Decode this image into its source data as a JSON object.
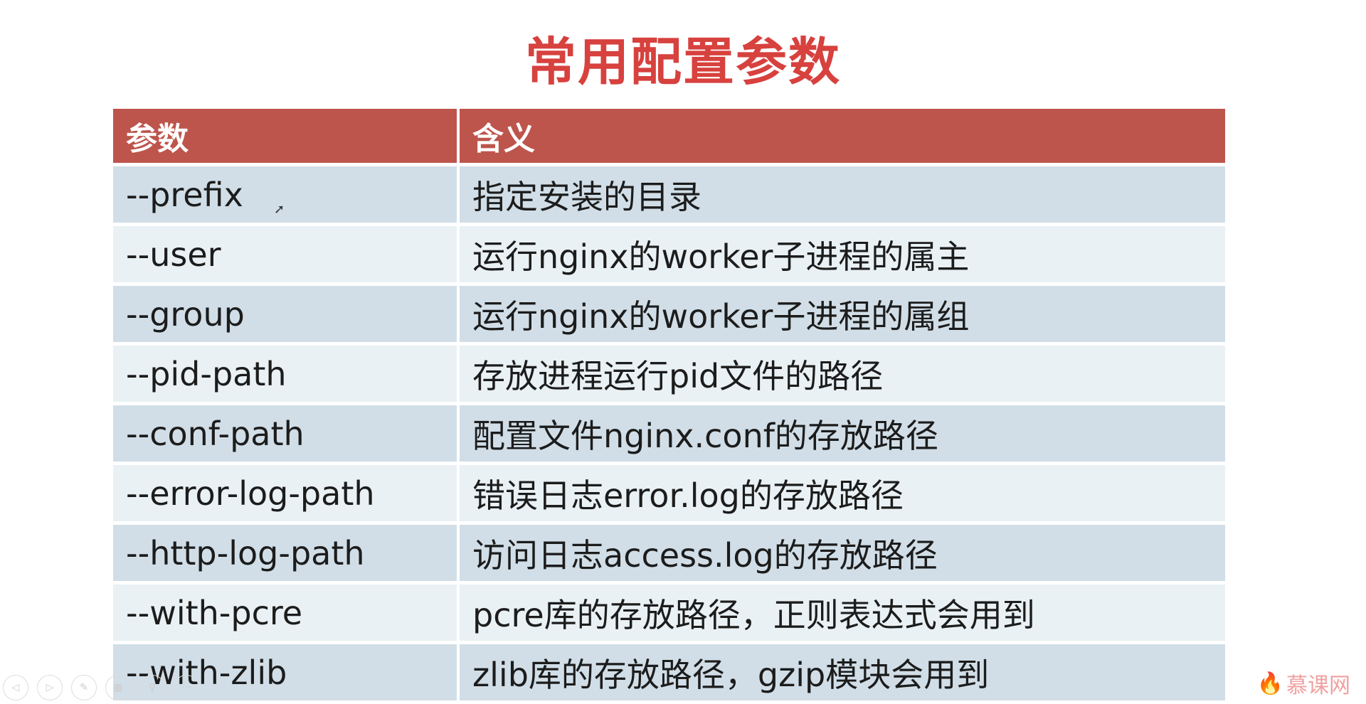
{
  "title": "常用配置参数",
  "table": {
    "headers": [
      "参数",
      "含义"
    ],
    "rows": [
      [
        "--prefix",
        "指定安装的目录"
      ],
      [
        "--user",
        "运行nginx的worker子进程的属主"
      ],
      [
        "--group",
        "运行nginx的worker子进程的属组"
      ],
      [
        "--pid-path",
        "存放进程运行pid文件的路径"
      ],
      [
        "--conf-path",
        "配置文件nginx.conf的存放路径"
      ],
      [
        "--error-log-path",
        "错误日志error.log的存放路径"
      ],
      [
        "--http-log-path",
        "访问日志access.log的存放路径"
      ],
      [
        "--with-pcre",
        "pcre库的存放路径，正则表达式会用到"
      ],
      [
        "--with-zlib",
        "zlib库的存放路径，gzip模块会用到"
      ]
    ]
  },
  "controls": [
    "previous-icon",
    "next-icon",
    "pen-icon",
    "slides-icon",
    "zoom-icon",
    "more-icon"
  ],
  "watermark": "慕课网",
  "colors": {
    "title": "#d7413e",
    "header": "#bd554c",
    "row_odd": "#d1dee7",
    "row_even": "#e9f1f4"
  }
}
